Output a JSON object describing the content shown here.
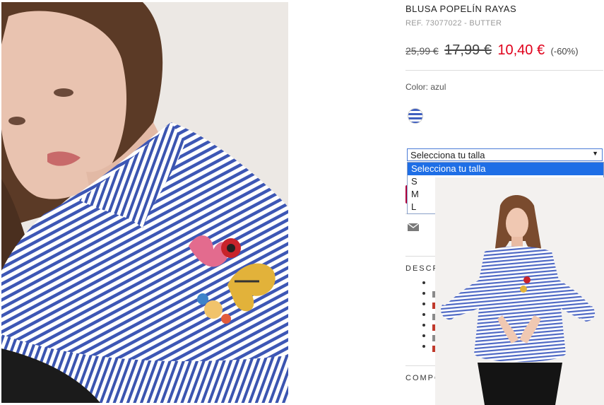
{
  "product": {
    "name": "BLUSA POPELÍN RAYAS",
    "reference": "REF. 73077022 - BUTTER",
    "price_original": "25,99 €",
    "price_previous": "17,99 €",
    "price_current": "10,40 €",
    "discount": "(-60%)"
  },
  "color": {
    "label": "Color: azul",
    "swatch_icon": "striped-blue-swatch"
  },
  "size_select": {
    "selected": "Selecciona tu talla",
    "options": [
      "Selecciona tu talla",
      "S",
      "M",
      "L"
    ]
  },
  "sections": {
    "description_fragment": "DESCR",
    "composition_fragment": "COMPO"
  },
  "icons": {
    "share": "envelope-icon",
    "dropdown": "caret-down-icon"
  },
  "colors": {
    "sale_red": "#e0001b",
    "accent_magenta": "#b0003a",
    "focus_blue": "#1e6ee6"
  }
}
